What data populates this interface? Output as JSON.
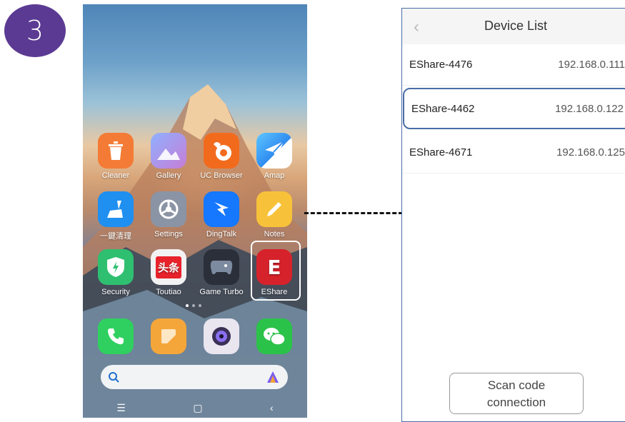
{
  "step": {
    "number": "3"
  },
  "phone": {
    "apps": [
      {
        "label": "Cleaner",
        "icon": "trash-icon",
        "color": "#f47b35"
      },
      {
        "label": "Gallery",
        "icon": "gallery-icon",
        "color": "#6f8ef0"
      },
      {
        "label": "UC Browser",
        "icon": "squirrel-icon",
        "color": "#f26b1d"
      },
      {
        "label": "Amap",
        "icon": "paper-plane-icon",
        "color": "#2f8cf0"
      },
      {
        "label": "一鍵清理",
        "icon": "broom-icon",
        "color": "#1f8ff0"
      },
      {
        "label": "Settings",
        "icon": "gear-icon",
        "color": "#8a94a4"
      },
      {
        "label": "DingTalk",
        "icon": "dingtalk-icon",
        "color": "#1677ff"
      },
      {
        "label": "Notes",
        "icon": "pencil-icon",
        "color": "#f7c23a"
      },
      {
        "label": "Security",
        "icon": "shield-icon",
        "color": "#2fbf71"
      },
      {
        "label": "Toutiao",
        "icon": "toutiao-icon",
        "color": "#f2f2f2",
        "glyph": "头条"
      },
      {
        "label": "Game Turbo",
        "icon": "gamepad-icon",
        "color": "#2a2f3a"
      },
      {
        "label": "EShare",
        "icon": "eshare-icon",
        "color": "#d6222b",
        "glyph": "E"
      }
    ],
    "dock": [
      {
        "icon": "phone-icon",
        "color": "#2fd05f"
      },
      {
        "icon": "notes-icon",
        "color": "#f5a63a"
      },
      {
        "icon": "camera-icon",
        "color": "#e9e6f0"
      },
      {
        "icon": "wechat-icon",
        "color": "#2bc24a"
      }
    ]
  },
  "device_list": {
    "title": "Device List",
    "devices": [
      {
        "name": "EShare-4476",
        "ip": "192.168.0.111"
      },
      {
        "name": "EShare-4462",
        "ip": "192.168.0.122"
      },
      {
        "name": "EShare-4671",
        "ip": "192.168.0.125"
      }
    ],
    "selected_index": 1,
    "scan_button": {
      "line1": "Scan code",
      "line2": "connection"
    }
  },
  "colors": {
    "badge": "#5b3a93",
    "selection_border": "#4a6da7"
  }
}
